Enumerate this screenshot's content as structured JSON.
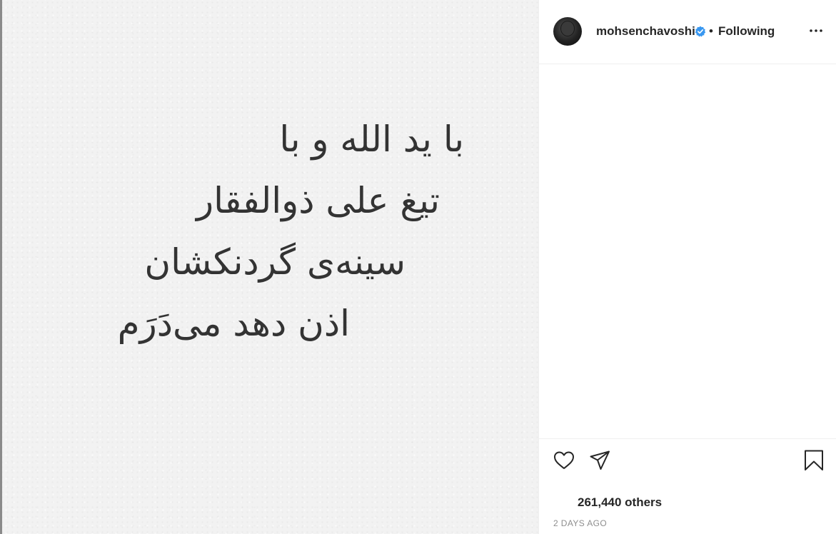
{
  "post": {
    "poem_lines": [
      "با ید الله و با",
      "تیغ علی ذوالفقار",
      "سینه‌ی گردنکشان",
      "اذن دهد می‌دَرَم"
    ]
  },
  "header": {
    "username": "mohsenchavoshi",
    "separator": "•",
    "follow_status": "Following",
    "verified_icon": "verified-badge-icon",
    "more_icon": "more-options-icon"
  },
  "actions": {
    "like_icon": "heart-icon",
    "share_icon": "paper-plane-icon",
    "save_icon": "bookmark-icon"
  },
  "likes": {
    "text": "261,440 others"
  },
  "timestamp": "2 DAYS AGO",
  "colors": {
    "accent_verified": "#3897f0",
    "text": "#262626",
    "muted": "#8e8e8e"
  }
}
